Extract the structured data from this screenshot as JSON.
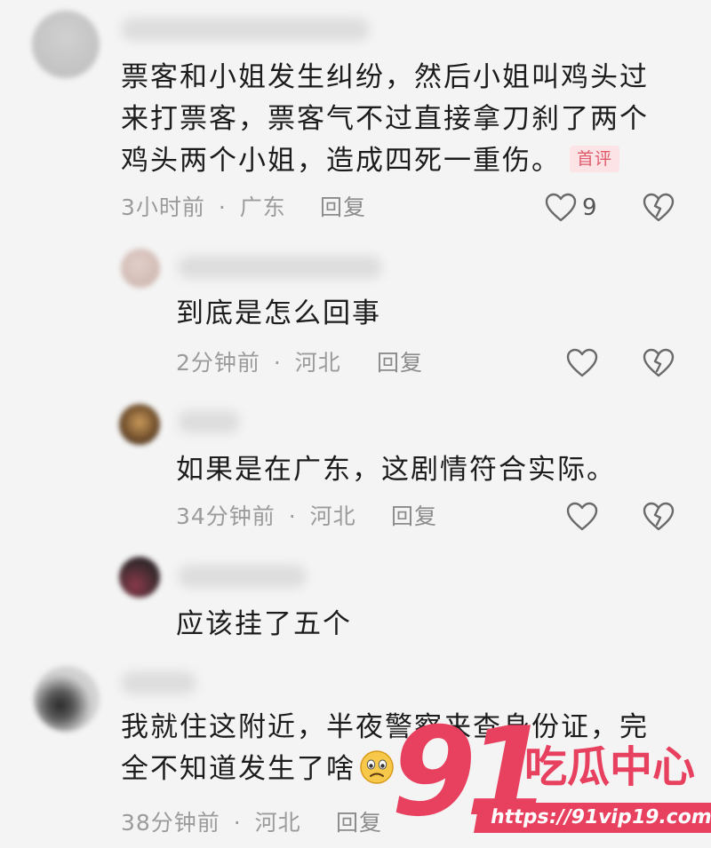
{
  "comments": [
    {
      "content_lines": [
        "票客和小姐发生纠纷，然后小姐叫鸡头过",
        "来打票客，票客气不过直接拿刀刹了两个",
        "鸡头两个小姐，造成四死一重伤。"
      ],
      "badge": "首评",
      "time": "3小时前",
      "region": "广东",
      "reply_label": "回复",
      "like_count": "9"
    },
    {
      "content_lines": [
        "到底是怎么回事"
      ],
      "time": "2分钟前",
      "region": "河北",
      "reply_label": "回复"
    },
    {
      "content_lines": [
        "如果是在广东，这剧情符合实际。"
      ],
      "time": "34分钟前",
      "region": "河北",
      "reply_label": "回复"
    },
    {
      "content_lines": [
        "应该挂了五个"
      ]
    },
    {
      "content_lines": [
        "我就住这附近，半夜警察来查身份证，完",
        "全不知道发生了啥"
      ],
      "emoji": "worried-face-emoji",
      "time": "38分钟前",
      "region": "河北",
      "reply_label": "回复"
    }
  ],
  "meta_separator": "·",
  "watermark": {
    "number": "91",
    "title": "吃瓜中心",
    "url": "https://91vip19.com"
  },
  "colors": {
    "background": "#f4f4f4",
    "text": "#1c1c1c",
    "meta": "#9b9b9b",
    "badge_text": "#e05a6a",
    "badge_bg": "#fbe3e6",
    "watermark": "#e8405f"
  }
}
